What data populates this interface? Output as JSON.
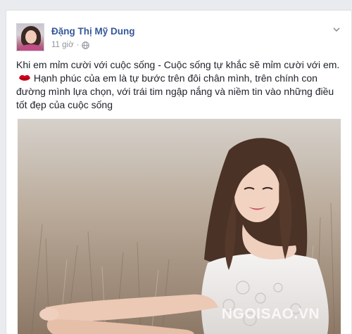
{
  "post": {
    "author_name": "Đặng Thị Mỹ Dung",
    "timestamp": "11 giờ",
    "separator": "·",
    "privacy_icon": "globe-icon",
    "options_icon": "chevron-down-icon",
    "text": "Khi em mỉm cười với cuộc sống - Cuộc sống tự khắc sẽ mỉm cười với em.",
    "text_emoji": "lips-emoji-icon",
    "text_2": "Hạnh phúc của em là tự bước trên đôi chân mình, trên chính con đường mình lựa chọn, với trái tim ngập nắng và niềm tin vào những điều tốt đẹp của cuộc sống",
    "photo": {
      "description_icon": "portrait-photo",
      "watermark": "NGOISAO.VN"
    }
  },
  "colors": {
    "page_bg": "#e9ebee",
    "author_link": "#365899",
    "meta_text": "#90949c",
    "body_text": "#1d2129",
    "emoji_red": "#d0021b"
  }
}
